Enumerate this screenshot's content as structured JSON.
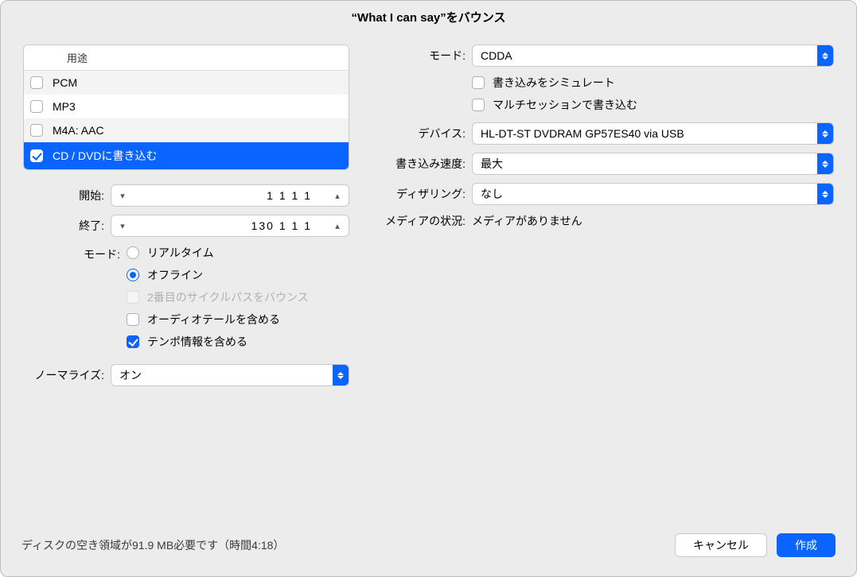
{
  "title": "“What I can say”をバウンス",
  "dest": {
    "header": "用途",
    "items": [
      {
        "label": "PCM",
        "checked": false,
        "selected": false
      },
      {
        "label": "MP3",
        "checked": false,
        "selected": false
      },
      {
        "label": "M4A: AAC",
        "checked": false,
        "selected": false
      },
      {
        "label": "CD / DVDに書き込む",
        "checked": true,
        "selected": true
      }
    ]
  },
  "left": {
    "start_label": "開始:",
    "start_value": "1 1 1    1",
    "end_label": "終了:",
    "end_value": "130 1 1    1",
    "mode_label": "モード:",
    "mode_realtime": "リアルタイム",
    "mode_offline": "オフライン",
    "second_cycle": "2番目のサイクルパスをバウンス",
    "include_tail": "オーディオテールを含める",
    "include_tempo": "テンポ情報を含める",
    "normalize_label": "ノーマライズ:",
    "normalize_value": "オン"
  },
  "right": {
    "mode_label": "モード:",
    "mode_value": "CDDA",
    "simulate": "書き込みをシミュレート",
    "multisession": "マルチセッションで書き込む",
    "device_label": "デバイス:",
    "device_value": "HL-DT-ST DVDRAM GP57ES40 via USB",
    "speed_label": "書き込み速度:",
    "speed_value": "最大",
    "dither_label": "ディザリング:",
    "dither_value": "なし",
    "media_label": "メディアの状況:",
    "media_value": "メディアがありません"
  },
  "footer": {
    "note": "ディスクの空き領域が91.9 MB必要です（時間4:18）",
    "cancel": "キャンセル",
    "create": "作成"
  }
}
